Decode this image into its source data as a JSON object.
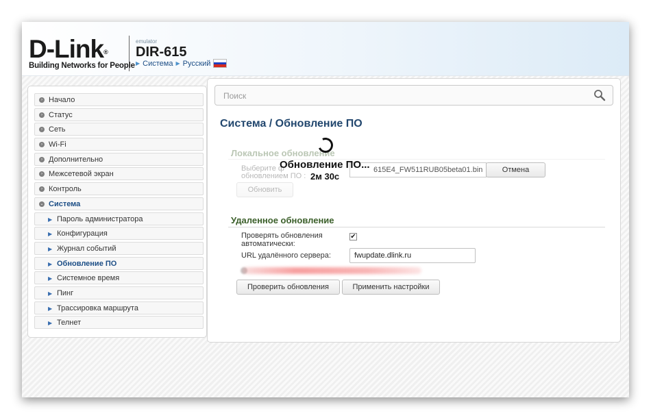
{
  "header": {
    "logo_text": "D-Link",
    "logo_reg": "®",
    "logo_tagline": "Building Networks for People",
    "emulator_label": "emulator",
    "model": "DIR-615",
    "breadcrumb": [
      "Система",
      "Русский"
    ],
    "language_flag": "russia-flag-icon"
  },
  "sidebar": {
    "items": [
      {
        "label": "Начало",
        "level": 0
      },
      {
        "label": "Статус",
        "level": 0
      },
      {
        "label": "Сеть",
        "level": 0
      },
      {
        "label": "Wi-Fi",
        "level": 0
      },
      {
        "label": "Дополнительно",
        "level": 0
      },
      {
        "label": "Межсетевой экран",
        "level": 0
      },
      {
        "label": "Контроль",
        "level": 0
      },
      {
        "label": "Система",
        "level": 0,
        "expanded": true
      },
      {
        "label": "Пароль администратора",
        "level": 1
      },
      {
        "label": "Конфигурация",
        "level": 1
      },
      {
        "label": "Журнал событий",
        "level": 1
      },
      {
        "label": "Обновление ПО",
        "level": 1,
        "active": true
      },
      {
        "label": "Системное время",
        "level": 1
      },
      {
        "label": "Пинг",
        "level": 1
      },
      {
        "label": "Трассировка маршрута",
        "level": 1
      },
      {
        "label": "Телнет",
        "level": 1
      }
    ]
  },
  "main": {
    "search_placeholder": "Поиск",
    "title": "Система /  Обновление ПО",
    "local": {
      "section_title": "Локальное обновление",
      "choose_label_1": "Выберите ф",
      "choose_label_2": "обновлением ПО :",
      "file_name": "615E4_FW511RUB05beta01.bin",
      "cancel_label": "Отмена",
      "update_label": "Обновить"
    },
    "remote": {
      "section_title": "Удаленное обновление",
      "auto_check_label_1": "Проверять обновления",
      "auto_check_label_2": "автоматически:",
      "auto_check_checked": true,
      "check_mark": "✔",
      "server_url_label": "URL удалённого сервера:",
      "server_url_value": "fwupdate.dlink.ru",
      "check_updates_label": "Проверить обновления",
      "apply_label": "Применить настройки"
    },
    "overlay": {
      "title": "Обновление ПО...",
      "timer": "2м 30с"
    }
  },
  "colors": {
    "accent": "#1c4e86",
    "section": "#3b5f2a",
    "title": "#22476e"
  }
}
